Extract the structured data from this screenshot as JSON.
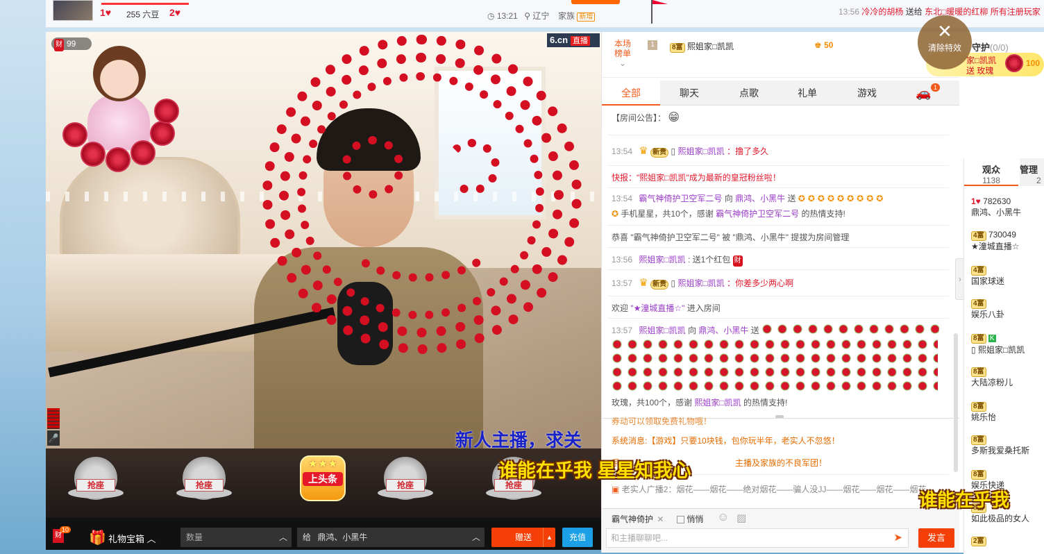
{
  "topbar": {
    "fans1_num": "1",
    "beans": "255 六豆",
    "fans2_num": "2",
    "time": "13:21",
    "location": "辽宁",
    "family_label": "家族",
    "family_badge": "新增",
    "broadcast_time": "13:56",
    "broadcast_user": "冷冷的胡杨",
    "broadcast_verb": "送给",
    "broadcast_target": "东北□暖暖的红柳",
    "broadcast_tail": "所有注册玩家"
  },
  "video": {
    "cai_count": "99",
    "cai_label": "财",
    "logo": "6.cn",
    "live_badge": "直播",
    "ticker": "新人主播，求关",
    "karaoke_line": "谁能在乎我  星星知我心",
    "karaoke_right": "谁能在乎我  "
  },
  "seats": {
    "grab_label": "抢座",
    "headline_label": "上头条",
    "stars": "★★★"
  },
  "gift_bar": {
    "cai_badge_count": "10",
    "cai_label": "财",
    "gift_box_label": "礼物宝箱",
    "quantity_placeholder": "数量",
    "to_prefix": "给",
    "to_value": "鼎鸿、小黑牛",
    "give_label": "赠送",
    "charge_label": "充值"
  },
  "rank": {
    "label_line1": "本场",
    "label_line2": "榜单",
    "position": "1",
    "rich_level": "8富",
    "user": "熙姐家□凯凯",
    "coins": "50"
  },
  "tabs": [
    "全部",
    "聊天",
    "点歌",
    "礼单",
    "游戏"
  ],
  "car_badge": "1",
  "chat": {
    "announcement": "【房间公告】：",
    "m1": {
      "time": "13:54",
      "badge": "新贵",
      "user": "熙姐家□凯凯",
      "text": "：撸了多久"
    },
    "m2": {
      "text": "快报：\"熙姐家□凯凯\"成为最新的皇冠粉丝啦！"
    },
    "m3": {
      "time": "13:54",
      "from": "霸气神倚护卫空军二号",
      "to_word": "向",
      "to": "鼎鸿、小黑牛",
      "send": "送"
    },
    "m3b": {
      "text1": "手机星星，共10个，感谢",
      "user": "霸气神倚护卫空军二号",
      "text2": "的热情支持!"
    },
    "m4": {
      "text": "恭喜 \"霸气神倚护卫空军二号\" 被 \"鼎鸿、小黑牛\" 提拔为房间管理"
    },
    "m5": {
      "time": "13:56",
      "user": "熙姐家□凯凯",
      "text": ": 送1个红包"
    },
    "m6": {
      "time": "13:57",
      "badge": "新贵",
      "user": "熙姐家□凯凯",
      "text": "：你差多少两心啊"
    },
    "m7": {
      "text1": "欢迎",
      "user": "\"★潼城直播☆\"",
      "text2": "进入房间"
    },
    "m8": {
      "time": "13:57",
      "from": "熙姐家□凯凯",
      "to_word": "向",
      "to": "鼎鸿、小黑牛",
      "send": "送"
    },
    "m8b": {
      "text1": "玫瑰，共100个，感谢",
      "user": "熙姐家□凯凯",
      "text2": "的热情支持!"
    }
  },
  "system": {
    "s0": "券动可以领取免费礼物哦！",
    "s1": "系统消息:【游戏】只要10块钱，包你玩半年，老实人不忽悠！",
    "s2_prefix": "系",
    "s2_tail": "主播及家族的不良军团！",
    "broadcast": "老实人广播2：烟花——烟花——绝对烟花——骗人没JJ——烟花——烟花——烟花"
  },
  "input_area": {
    "target_chip": "霸气神倚护",
    "private_label": "悄悄",
    "chat_placeholder": "和主播聊聊吧...",
    "send_label": "发言"
  },
  "right": {
    "guard_label": "守护",
    "guard_count": "(0/0)",
    "gift_user": "家□凯凯",
    "gift_text": "送 玫瑰",
    "gift_count": "100",
    "clear_label": "清除特效",
    "viewers_tab": "观众",
    "viewers_count": "1138",
    "admins_tab": "管理",
    "admins_count": "2",
    "viewers": [
      {
        "badge": "",
        "line1": "782630",
        "name": "鼎鸿、小黑牛"
      },
      {
        "badge": "4富",
        "line1": "730049",
        "name": "★潼城直播☆"
      },
      {
        "badge": "4富",
        "line1": "",
        "name": "国家球迷"
      },
      {
        "badge": "4富",
        "line1": "",
        "name": "娱乐八卦"
      },
      {
        "badge": "8富",
        "line1": "",
        "name": "熙姐家□凯凯"
      },
      {
        "badge": "8富",
        "line1": "",
        "name": "大陆凉粉儿"
      },
      {
        "badge": "8富",
        "line1": "",
        "name": "姚乐怡"
      },
      {
        "badge": "8富",
        "line1": "",
        "name": "多斯我爱桑托斯"
      },
      {
        "badge": "8富",
        "line1": "",
        "name": "娱乐快递"
      },
      {
        "badge": "8富",
        "line1": "",
        "name": "如此极品的女人"
      },
      {
        "badge": "2富",
        "line1": "",
        "name": ""
      }
    ]
  }
}
